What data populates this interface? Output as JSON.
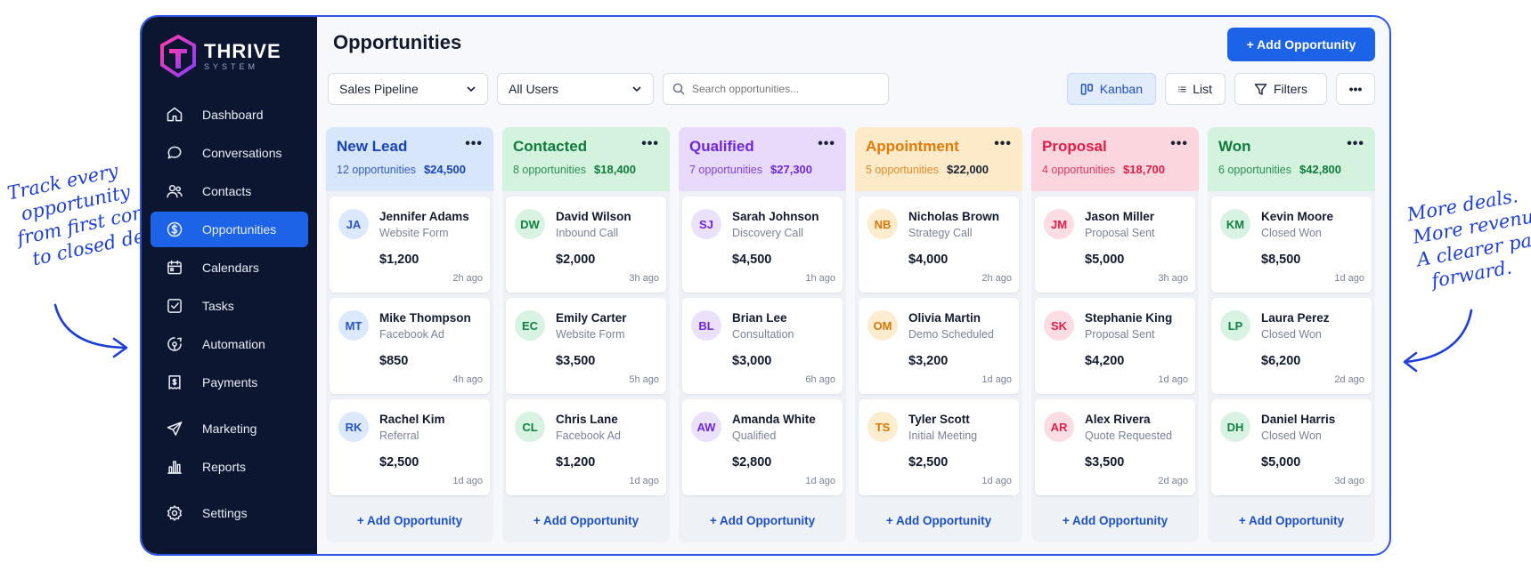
{
  "notes": {
    "left": [
      "Track every",
      "opportunity",
      "from first contact",
      "to closed deal."
    ],
    "right": [
      "More deals.",
      "More revenue.",
      "A clearer path",
      "forward."
    ]
  },
  "brand": {
    "name": "THRIVE",
    "sub": "SYSTEM"
  },
  "sidebar": {
    "items": [
      {
        "label": "Dashboard",
        "icon": "home-icon",
        "active": false
      },
      {
        "label": "Conversations",
        "icon": "chat-bubble-icon",
        "active": false
      },
      {
        "label": "Contacts",
        "icon": "users-icon",
        "active": false
      },
      {
        "label": "Opportunities",
        "icon": "dollar-circle-icon",
        "active": true
      },
      {
        "label": "Calendars",
        "icon": "calendar-icon",
        "active": false
      },
      {
        "label": "Tasks",
        "icon": "checkbox-icon",
        "active": false
      },
      {
        "label": "Automation",
        "icon": "automation-icon",
        "active": false
      },
      {
        "label": "Payments",
        "icon": "receipt-icon",
        "active": false
      },
      {
        "label": "Marketing",
        "icon": "paper-plane-icon",
        "active": false
      },
      {
        "label": "Reports",
        "icon": "bar-chart-icon",
        "active": false
      },
      {
        "label": "Settings",
        "icon": "gear-icon",
        "active": false
      }
    ]
  },
  "header": {
    "title": "Opportunities",
    "add_label": "+ Add Opportunity"
  },
  "toolbar": {
    "pipeline": "Sales Pipeline",
    "users": "All Users",
    "search_placeholder": "Search opportunities...",
    "kanban": "Kanban",
    "list": "List",
    "filters": "Filters",
    "more": "•••"
  },
  "columns": [
    {
      "title": "New Lead",
      "count": "12 opportunities",
      "value": "$24,500",
      "head_bg": "#d7e6fb",
      "title_color": "#1743b8",
      "value_color": "#1743b8",
      "cards": [
        {
          "initials": "JA",
          "name": "Jennifer Adams",
          "source": "Website Form",
          "amount": "$1,200",
          "time": "2h ago"
        },
        {
          "initials": "MT",
          "name": "Mike Thompson",
          "source": "Facebook Ad",
          "amount": "$850",
          "time": "4h ago"
        },
        {
          "initials": "RK",
          "name": "Rachel Kim",
          "source": "Referral",
          "amount": "$2,500",
          "time": "1d ago"
        }
      ],
      "avatar_bg": "#dce8fb",
      "avatar_fg": "#2656c8"
    },
    {
      "title": "Contacted",
      "count": "8 opportunities",
      "value": "$18,400",
      "head_bg": "#d4f3df",
      "title_color": "#0f7a3c",
      "value_color": "#0f7a3c",
      "cards": [
        {
          "initials": "DW",
          "name": "David Wilson",
          "source": "Inbound Call",
          "amount": "$2,000",
          "time": "3h ago"
        },
        {
          "initials": "EC",
          "name": "Emily Carter",
          "source": "Website Form",
          "amount": "$3,500",
          "time": "5h ago"
        },
        {
          "initials": "CL",
          "name": "Chris Lane",
          "source": "Facebook Ad",
          "amount": "$1,200",
          "time": "1d ago"
        }
      ],
      "avatar_bg": "#d8f3e1",
      "avatar_fg": "#138043"
    },
    {
      "title": "Qualified",
      "count": "7 opportunities",
      "value": "$27,300",
      "head_bg": "#e8dafa",
      "title_color": "#6d28d9",
      "value_color": "#6d28d9",
      "cards": [
        {
          "initials": "SJ",
          "name": "Sarah Johnson",
          "source": "Discovery Call",
          "amount": "$4,500",
          "time": "1h ago"
        },
        {
          "initials": "BL",
          "name": "Brian Lee",
          "source": "Consultation",
          "amount": "$3,000",
          "time": "6h ago"
        },
        {
          "initials": "AW",
          "name": "Amanda White",
          "source": "Qualified",
          "amount": "$2,800",
          "time": "1d ago"
        }
      ],
      "avatar_bg": "#ece1fb",
      "avatar_fg": "#6d28d9"
    },
    {
      "title": "Appointment",
      "count": "5 opportunities",
      "value": "$22,000",
      "head_bg": "#fdeac9",
      "title_color": "#e07b0a",
      "value_color": "#1a2233",
      "cards": [
        {
          "initials": "NB",
          "name": "Nicholas Brown",
          "source": "Strategy Call",
          "amount": "$4,000",
          "time": "2h ago"
        },
        {
          "initials": "OM",
          "name": "Olivia Martin",
          "source": "Demo Scheduled",
          "amount": "$3,200",
          "time": "1d ago"
        },
        {
          "initials": "TS",
          "name": "Tyler Scott",
          "source": "Initial Meeting",
          "amount": "$2,500",
          "time": "1d ago"
        }
      ],
      "avatar_bg": "#fdedcf",
      "avatar_fg": "#d97706"
    },
    {
      "title": "Proposal",
      "count": "4 opportunities",
      "value": "$18,700",
      "head_bg": "#fbd6df",
      "title_color": "#e11d48",
      "value_color": "#e11d48",
      "cards": [
        {
          "initials": "JM",
          "name": "Jason Miller",
          "source": "Proposal Sent",
          "amount": "$5,000",
          "time": "3h ago"
        },
        {
          "initials": "SK",
          "name": "Stephanie King",
          "source": "Proposal Sent",
          "amount": "$4,200",
          "time": "1d ago"
        },
        {
          "initials": "AR",
          "name": "Alex Rivera",
          "source": "Quote Requested",
          "amount": "$3,500",
          "time": "2d ago"
        }
      ],
      "avatar_bg": "#fcdde4",
      "avatar_fg": "#e11d48"
    },
    {
      "title": "Won",
      "count": "6 opportunities",
      "value": "$42,800",
      "head_bg": "#d4f3df",
      "title_color": "#0f7a3c",
      "value_color": "#0f7a3c",
      "cards": [
        {
          "initials": "KM",
          "name": "Kevin Moore",
          "source": "Closed Won",
          "amount": "$8,500",
          "time": "1d ago"
        },
        {
          "initials": "LP",
          "name": "Laura Perez",
          "source": "Closed Won",
          "amount": "$6,200",
          "time": "2d ago"
        },
        {
          "initials": "DH",
          "name": "Daniel Harris",
          "source": "Closed Won",
          "amount": "$5,000",
          "time": "3d ago"
        }
      ],
      "avatar_bg": "#d8f3e1",
      "avatar_fg": "#138043"
    }
  ],
  "column_add_label": "+ Add Opportunity",
  "column_more": "•••"
}
